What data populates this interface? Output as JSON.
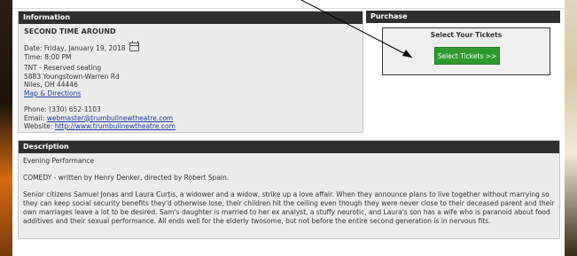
{
  "info": {
    "header": "Information",
    "show_title": "SECOND TIME AROUND",
    "date": "Date: Friday, January 19, 2018",
    "time": "Time: 8:00 PM",
    "venue": "TNT - Reserved seating",
    "address1": "5883 Youngstown-Warren Rd",
    "address2": "Niles, OH 44446",
    "map_link": "Map & Directions",
    "phone": "Phone: (330) 652-1103",
    "email_label": "Email: ",
    "email": "webmaster@trumbullnewtheatre.com",
    "website_label": "Website: ",
    "website": "http://www.trumbullnewtheatre.com"
  },
  "purchase": {
    "header": "Purchase",
    "select_title": "Select Your Tickets",
    "button": "Select Tickets >>"
  },
  "description": {
    "header": "Description",
    "line1": "Evening Performance",
    "line2": "COMEDY - written by Henry Denker, directed by Robert Spain.",
    "body": "Senior citizens Samuel Jonas and Laura Curtis, a widower and a widow, strike up a love affair. When they announce plans to live together without marrying so they can keep social security benefits they'd otherwise lose, their children hit the ceiling even though they were never close to their deceased parent and their own marriages leave a lot to be desired. Sam's daughter is married to her ex analyst, a stuffy neurotic, and Laura's son has a wife who is paranoid about food additives and their sexual performance. All ends well for the elderly twosome, but not before the entire second generation is in nervous fits."
  },
  "colors": {
    "header_bg": "#2f2f2f",
    "button_bg": "#2e9a2e",
    "link": "#1a3a9e"
  },
  "icons": [
    "calendar-icon"
  ]
}
